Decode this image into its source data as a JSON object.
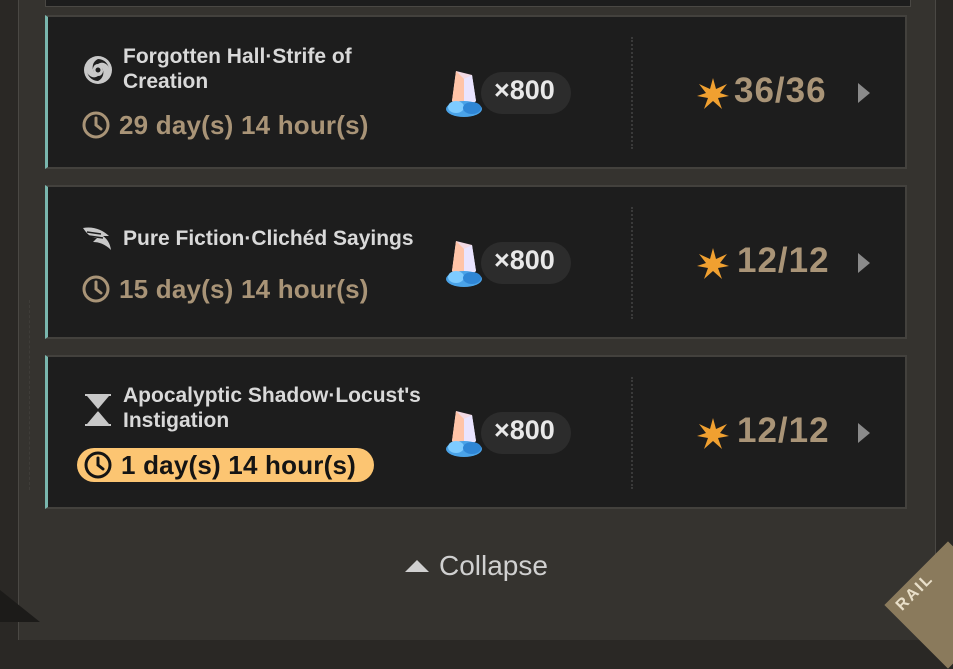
{
  "cards": [
    {
      "title_line1": "Forgotten Hall·Strife of",
      "title_line2": "Creation",
      "timer": "29 day(s) 14 hour(s)",
      "reward": "×800",
      "stars": "36/36",
      "icon": "forgotten-hall-swirl-icon",
      "urgent": false
    },
    {
      "title_line1": "Pure Fiction·Clichéd Sayings",
      "title_line2": "",
      "timer": "15 day(s) 14 hour(s)",
      "reward": "×800",
      "stars": "12/12",
      "icon": "pure-fiction-wing-icon",
      "urgent": false
    },
    {
      "title_line1": "Apocalyptic Shadow·Locust's",
      "title_line2": "Instigation",
      "timer": "1 day(s) 14 hour(s)",
      "reward": "×800",
      "stars": "12/12",
      "icon": "apocalyptic-shadow-hourglass-icon",
      "urgent": true
    }
  ],
  "collapse_label": "Collapse",
  "corner_label": "RAIL",
  "colors": {
    "accent_bar": "#79b6ad",
    "timer_text": "#a99477",
    "urgent_badge": "#fcc572",
    "star": "#f0a030"
  }
}
